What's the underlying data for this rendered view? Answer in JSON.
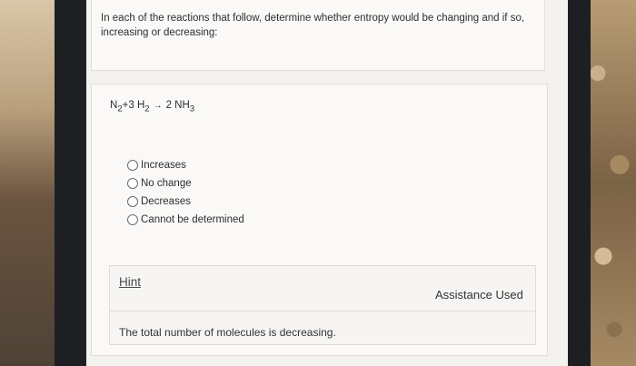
{
  "question": {
    "prompt": "In each of the reactions that follow, determine whether entropy would be changing and if so, increasing or decreasing:"
  },
  "reaction": {
    "reactant1": "N",
    "reactant1_sub": "2",
    "plus": "+3 H",
    "reactant2_sub": "2",
    "arrow": "→",
    "product": "2 NH",
    "product_sub": "3"
  },
  "options": [
    {
      "label": "Increases",
      "selected": false
    },
    {
      "label": "No change",
      "selected": false
    },
    {
      "label": "Decreases",
      "selected": false
    },
    {
      "label": "Cannot be determined",
      "selected": false
    }
  ],
  "hint": {
    "link_label": "Hint",
    "status": "Assistance Used",
    "text": "The total number of molecules is decreasing."
  }
}
